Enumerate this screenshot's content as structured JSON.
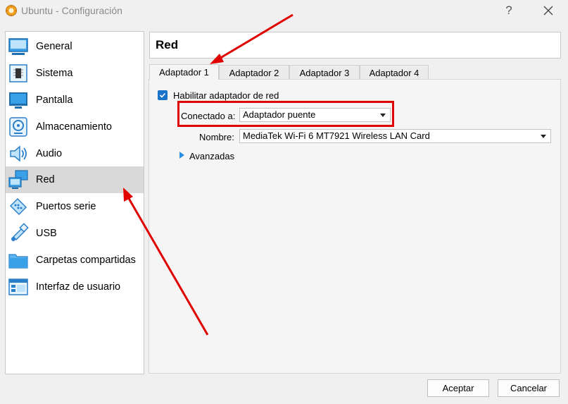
{
  "window": {
    "title": "Ubuntu - Configuración",
    "help_label": "?"
  },
  "sidebar": {
    "items": [
      {
        "label": "General",
        "icon": "monitor-icon"
      },
      {
        "label": "Sistema",
        "icon": "chip-icon"
      },
      {
        "label": "Pantalla",
        "icon": "display-icon"
      },
      {
        "label": "Almacenamiento",
        "icon": "disk-icon"
      },
      {
        "label": "Audio",
        "icon": "speaker-icon"
      },
      {
        "label": "Red",
        "icon": "network-icon"
      },
      {
        "label": "Puertos serie",
        "icon": "serial-port-icon"
      },
      {
        "label": "USB",
        "icon": "usb-icon"
      },
      {
        "label": "Carpetas compartidas",
        "icon": "folder-icon"
      },
      {
        "label": "Interfaz de usuario",
        "icon": "ui-window-icon"
      }
    ],
    "selected": "Red"
  },
  "main": {
    "title": "Red",
    "tabs": [
      {
        "label": "Adaptador 1"
      },
      {
        "label": "Adaptador 2"
      },
      {
        "label": "Adaptador 3"
      },
      {
        "label": "Adaptador 4"
      }
    ],
    "active_tab": "Adaptador 1",
    "enable_adapter": {
      "label": "Habilitar adaptador de red",
      "checked": true
    },
    "connected_to": {
      "label": "Conectado a:",
      "value": "Adaptador puente"
    },
    "name": {
      "label": "Nombre:",
      "value": "MediaTek Wi-Fi 6 MT7921 Wireless LAN Card"
    },
    "advanced": {
      "label": "Avanzadas"
    }
  },
  "buttons": {
    "accept": "Aceptar",
    "cancel": "Cancelar"
  },
  "colors": {
    "accent": "#1a73c8",
    "annotation": "#e00000",
    "selection": "#d9d9d9"
  }
}
